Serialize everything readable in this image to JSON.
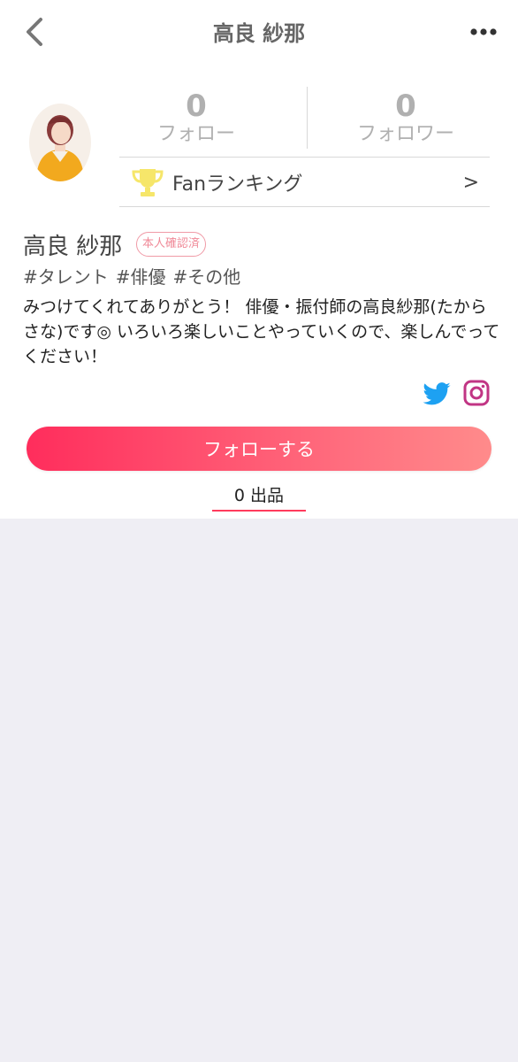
{
  "header": {
    "title": "高良 紗那"
  },
  "stats": {
    "following_count": "0",
    "following_label": "フォロー",
    "followers_count": "0",
    "followers_label": "フォロワー"
  },
  "ranking": {
    "label": "Fanランキング",
    "arrow": ">"
  },
  "profile": {
    "name": "高良 紗那",
    "verified_badge": "本人確認済",
    "tags": [
      "#タレント",
      "#俳優",
      "#その他"
    ],
    "bio": "みつけてくれてありがとう！ 俳優・振付師の高良紗那(たからさな)です◎ いろいろ楽しいことやっていくので、楽しんでってください！"
  },
  "social": {
    "twitter_icon": "twitter-icon",
    "instagram_icon": "instagram-icon",
    "twitter_color": "#1da1f2",
    "instagram_color": "#c13584"
  },
  "actions": {
    "follow_label": "フォローする"
  },
  "tabs": {
    "items_label": "0 出品"
  },
  "colors": {
    "accent": "#ff3b5c",
    "background": "#efeef4"
  }
}
